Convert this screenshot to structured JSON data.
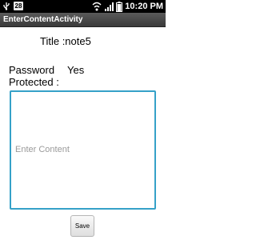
{
  "status_bar": {
    "notification_count": "28",
    "time": "10:20 PM",
    "icons": [
      "usb-icon",
      "wifi-icon",
      "signal-icon",
      "battery-icon"
    ]
  },
  "title_bar": {
    "title": "EnterContentActivity"
  },
  "note": {
    "title_text": "Title :note5",
    "password_label": "Password Protected :",
    "password_value": "Yes"
  },
  "content_field": {
    "placeholder": "Enter Content",
    "value": ""
  },
  "save_button": {
    "label": "Save"
  },
  "colors": {
    "field_border": "#35a1c8",
    "title_bar": "#4a4a4a",
    "placeholder": "#9a9a9a"
  }
}
